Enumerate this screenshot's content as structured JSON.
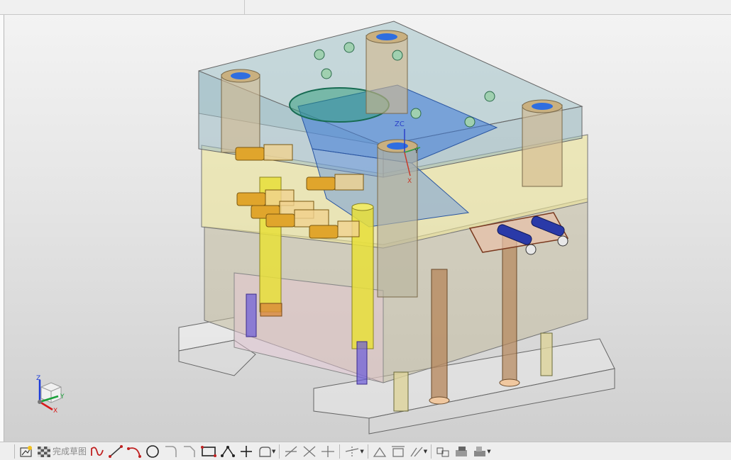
{
  "toolbar": {
    "finish_sketch_label": "完成草图"
  },
  "triad": {
    "z_label": "Z",
    "y_label": "Y",
    "x_label": "X"
  },
  "wcs": {
    "zc_label": "ZC",
    "y_label": "Y",
    "x_label": "X"
  },
  "colors": {
    "plate_top": "#9dbcc4",
    "plate_yellow": "#e9e29a",
    "plate_grey": "#c9c3a5",
    "cavity_blue": "#3a78d8",
    "pin_yellow": "#e8df38",
    "pin_brown": "#b5865a"
  }
}
